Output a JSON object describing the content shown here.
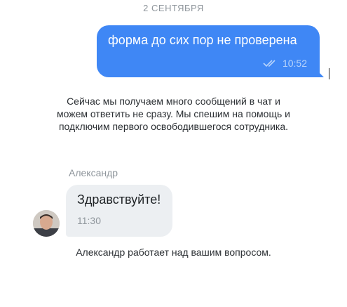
{
  "chat": {
    "date_separator": "2 СЕНТЯБРЯ",
    "outgoing": {
      "text": "форма до сих пор не проверена",
      "time": "10:52",
      "status_icon": "double-check-icon",
      "bubble_color": "#3f87f5"
    },
    "system_messages": [
      "Сейчас мы получаем много сообщений в чат и можем ответить не сразу. Мы спешим на помощь и подключим первого освободившегося сотрудника.",
      "Александр работает над вашим вопросом."
    ],
    "incoming": {
      "sender": "Александр",
      "text": "Здравствуйте!",
      "time": "11:30",
      "avatar": "agent-avatar",
      "bubble_color": "#eceff2"
    }
  }
}
